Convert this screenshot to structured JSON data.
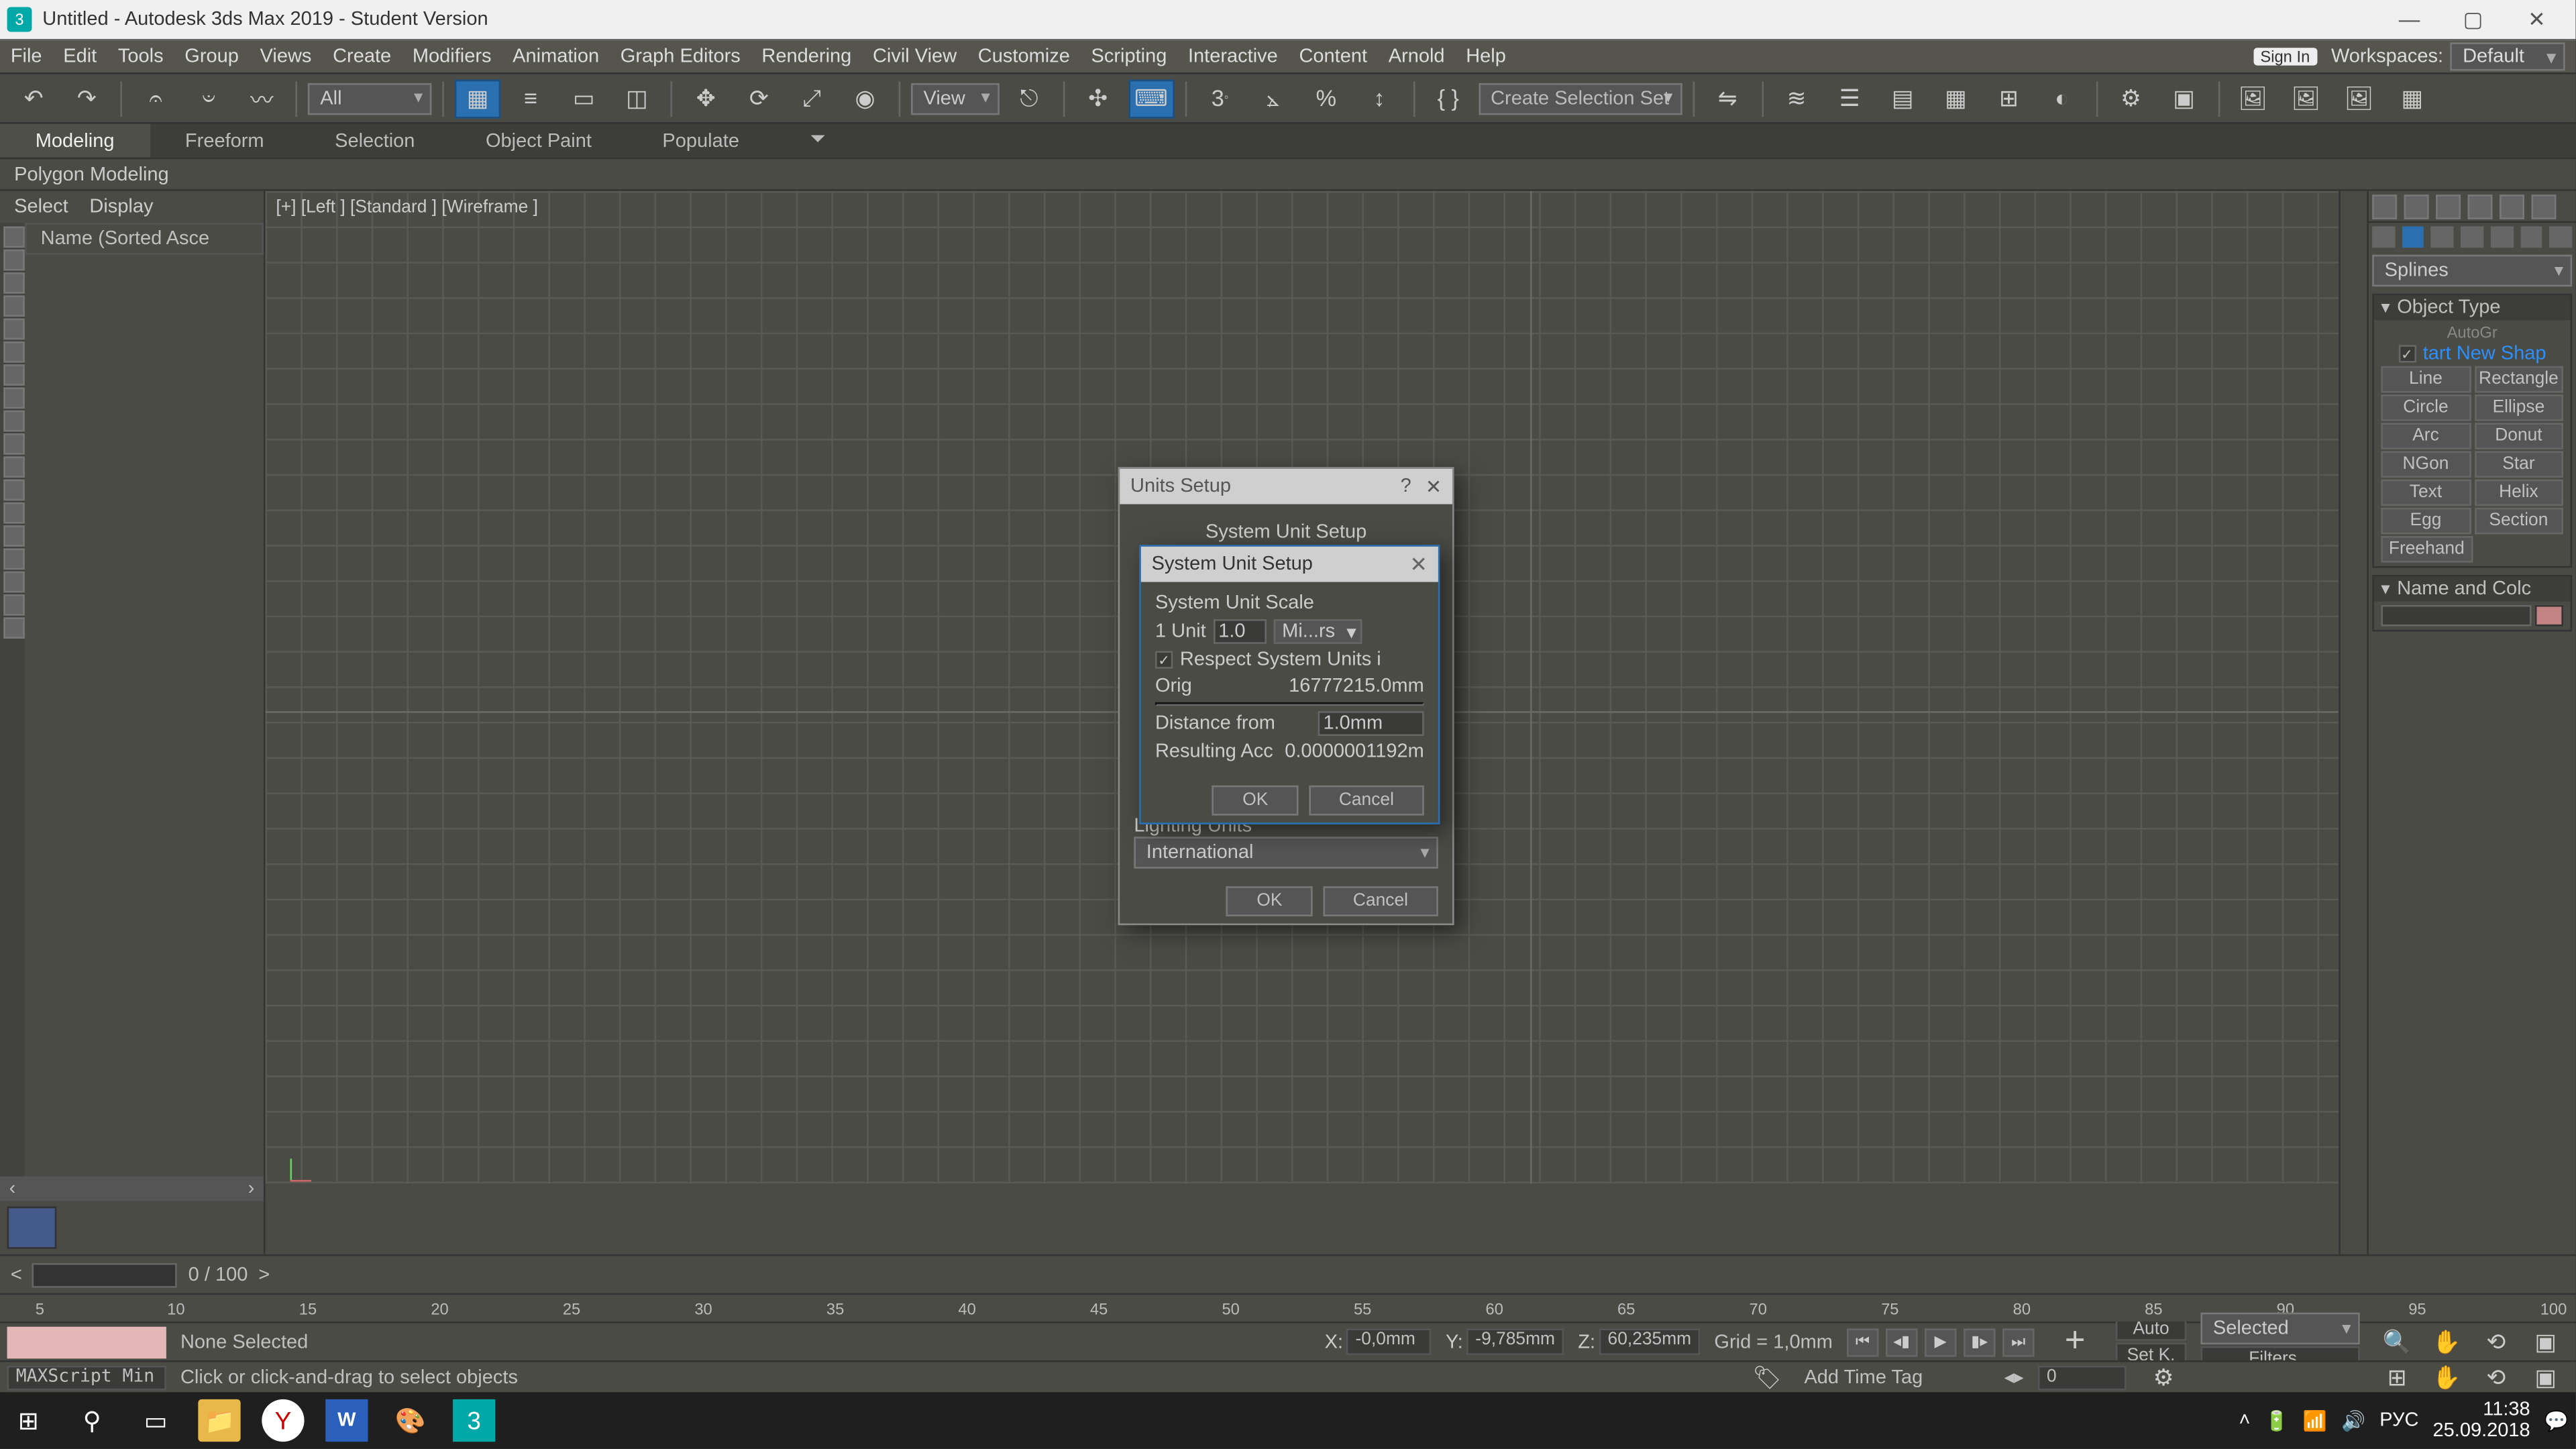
{
  "title": "Untitled - Autodesk 3ds Max 2019 - Student Version",
  "menus": [
    "File",
    "Edit",
    "Tools",
    "Group",
    "Views",
    "Create",
    "Modifiers",
    "Animation",
    "Graph Editors",
    "Rendering",
    "Civil View",
    "Customize",
    "Scripting",
    "Interactive",
    "Content",
    "Arnold",
    "Help"
  ],
  "signin": "Sign In",
  "workspaces_label": "Workspaces:",
  "workspaces_value": "Default",
  "filter_all": "All",
  "view_label": "View",
  "selection_set": "Create Selection Set",
  "ribbon": {
    "tabs": [
      "Modeling",
      "Freeform",
      "Selection",
      "Object Paint",
      "Populate"
    ],
    "active": "Modeling",
    "poly": "Polygon Modeling"
  },
  "scene_explorer": {
    "select": "Select",
    "display": "Display",
    "col": "Name (Sorted Asce"
  },
  "viewport_label": "[+] [Left ]  [Standard ] [Wireframe ]",
  "slider_label": "0 / 100",
  "ticks": [
    "5",
    "10",
    "15",
    "20",
    "25",
    "30",
    "35",
    "40",
    "45",
    "50",
    "55",
    "60",
    "65",
    "70",
    "75",
    "80",
    "85",
    "90",
    "95",
    "100"
  ],
  "status": {
    "selection": "None Selected",
    "prompt": "Click or click-and-drag to select objects",
    "x_label": "X:",
    "x": "-0,0mm",
    "y_label": "Y:",
    "y": "-9,785mm",
    "z_label": "Z:",
    "z": "60,235mm",
    "grid": "Grid = 1,0mm",
    "addtime": "Add Time Tag",
    "maxscript": "MAXScript Min",
    "auto": "Auto",
    "setk": "Set K.",
    "selected": "Selected",
    "filters": "Filters...",
    "frame": "0"
  },
  "cmd": {
    "category": "Splines",
    "obj_type": "Object Type",
    "autogrid": "AutoGr",
    "startnew": "tart New Shap",
    "buttons": [
      [
        "Line",
        "Rectangle"
      ],
      [
        "Circle",
        "Ellipse"
      ],
      [
        "Arc",
        "Donut"
      ],
      [
        "NGon",
        "Star"
      ],
      [
        "Text",
        "Helix"
      ],
      [
        "Egg",
        "Section"
      ]
    ],
    "freehand": "Freehand",
    "name_color": "Name and Colc"
  },
  "units_dialog": {
    "title": "Units Setup",
    "sys_btn": "System Unit Setup",
    "lighting": "Lighting Units",
    "intl": "International",
    "ok": "OK",
    "cancel": "Cancel"
  },
  "sys_dialog": {
    "title": "System Unit Setup",
    "scale": "System Unit Scale",
    "unit_lbl": "1 Unit",
    "unit_val": "1.0",
    "unit_type": "Mi...rs",
    "respect": "Respect System Units i",
    "orig": "Orig",
    "orig_val": "16777215.0mm",
    "dist": "Distance from",
    "dist_val": "1.0mm",
    "result": "Resulting Acc",
    "result_val": "0.0000001192m",
    "ok": "OK",
    "cancel": "Cancel"
  },
  "taskbar": {
    "lang": "РУС",
    "time": "11:38",
    "date": "25.09.2018",
    "badge": "3"
  }
}
